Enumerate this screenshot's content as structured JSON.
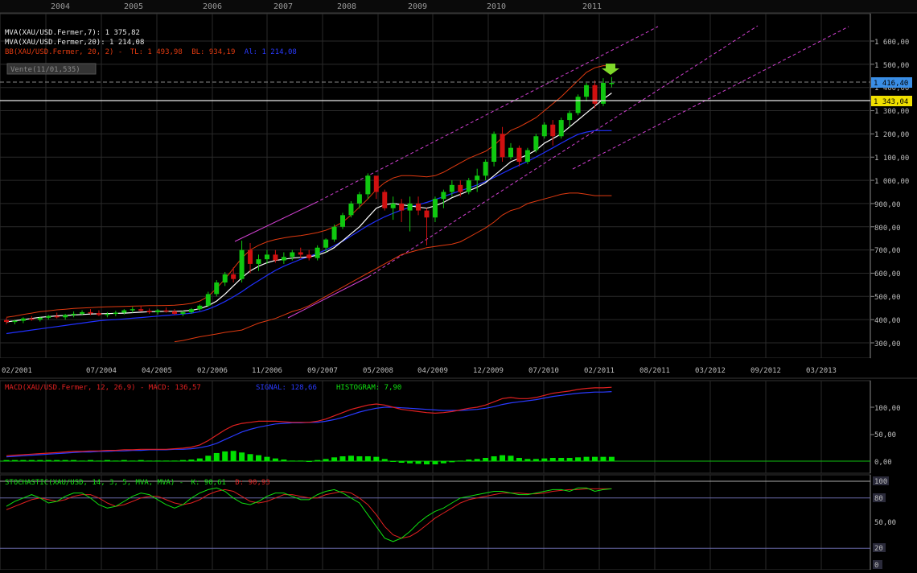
{
  "colors": {
    "background": "#000000",
    "grid": "#2a2a2a",
    "up_candle": "#10c810",
    "down_candle": "#d01010",
    "mva7": "#ffffff",
    "mva20": "#2030ff",
    "bb": "#e03a10",
    "trend": "#d040d0",
    "macd": "#e02020",
    "signal": "#2a3aff",
    "histogram": "#00e000",
    "stoch_k": "#10e010",
    "stoch_d": "#e02020",
    "price_badge": "#3a8ee6",
    "level_badge": "#f0e000"
  },
  "header": {
    "years": [
      "2004",
      "2005",
      "2006",
      "2007",
      "2008",
      "2009",
      "2010",
      "2011"
    ]
  },
  "price_panel": {
    "legend_mva7": "MVA(XAU/USD.Fermer,7): 1 375,82",
    "legend_mva20": "MVA(XAU/USD.Fermer,20): 1 214,08",
    "legend_bb_name": "BB(XAU/USD.Fermer, 20, 2) -",
    "legend_bb_tl": "TL: 1 493,98",
    "legend_bb_bl": "BL: 934,19",
    "legend_bb_al": "Al: 1 214,08",
    "order_label": "Vente(11/01,535)",
    "last_price": "1 416,40",
    "level_price": "1 343,04",
    "y_ticks": [
      "1 600,00",
      "1 500,00",
      "1 400,00",
      "1 300,00",
      "1 200,00",
      "1 100,00",
      "1 000,00",
      "900,00",
      "800,00",
      "700,00",
      "600,00",
      "500,00",
      "400,00",
      "300,00"
    ],
    "x_ticks": [
      "02/2001",
      "07/2004",
      "04/2005",
      "02/2006",
      "11/2006",
      "09/2007",
      "05/2008",
      "04/2009",
      "12/2009",
      "07/2010",
      "02/2011",
      "08/2011",
      "03/2012",
      "09/2012",
      "03/2013"
    ]
  },
  "macd_panel": {
    "legend_macd": "MACD(XAU/USD.Fermer, 12, 26,9) - MACD: 136,57",
    "legend_signal": "SIGNAL: 128,66",
    "legend_hist": "HISTOGRAM: 7,90",
    "y_ticks": [
      "100,00",
      "50,00",
      "0,00"
    ]
  },
  "stoch_panel": {
    "legend_name": "STOCHASTIC(XAU/USD, 14, 3, 5, MVA, MVA) -",
    "legend_k": "K: 90,61",
    "legend_d": "D: 90,93",
    "y_ticks": [
      "100",
      "80",
      "50,00",
      "20",
      "0"
    ]
  },
  "chart_data": {
    "type": "candlestick",
    "instrument": "XAU/USD",
    "ylim": [
      280,
      1660
    ],
    "candles": [
      [
        398,
        408,
        380,
        390
      ],
      [
        390,
        400,
        380,
        395
      ],
      [
        395,
        410,
        385,
        405
      ],
      [
        405,
        415,
        395,
        400
      ],
      [
        400,
        412,
        392,
        408
      ],
      [
        408,
        420,
        400,
        415
      ],
      [
        415,
        430,
        405,
        410
      ],
      [
        410,
        425,
        400,
        420
      ],
      [
        420,
        435,
        410,
        425
      ],
      [
        425,
        440,
        418,
        432
      ],
      [
        432,
        445,
        420,
        428
      ],
      [
        428,
        440,
        415,
        420
      ],
      [
        420,
        432,
        410,
        425
      ],
      [
        425,
        438,
        415,
        430
      ],
      [
        430,
        445,
        422,
        440
      ],
      [
        440,
        455,
        430,
        445
      ],
      [
        445,
        460,
        435,
        438
      ],
      [
        438,
        448,
        425,
        432
      ],
      [
        432,
        445,
        422,
        440
      ],
      [
        440,
        452,
        430,
        436
      ],
      [
        436,
        445,
        420,
        425
      ],
      [
        425,
        438,
        415,
        432
      ],
      [
        432,
        450,
        425,
        445
      ],
      [
        445,
        465,
        438,
        460
      ],
      [
        460,
        520,
        455,
        510
      ],
      [
        510,
        570,
        500,
        560
      ],
      [
        560,
        605,
        545,
        595
      ],
      [
        595,
        625,
        560,
        575
      ],
      [
        575,
        740,
        560,
        700
      ],
      [
        700,
        730,
        600,
        640
      ],
      [
        640,
        680,
        610,
        660
      ],
      [
        660,
        700,
        640,
        680
      ],
      [
        680,
        700,
        645,
        655
      ],
      [
        655,
        690,
        640,
        670
      ],
      [
        670,
        700,
        655,
        690
      ],
      [
        690,
        710,
        665,
        680
      ],
      [
        680,
        700,
        655,
        665
      ],
      [
        665,
        720,
        655,
        710
      ],
      [
        710,
        750,
        690,
        745
      ],
      [
        745,
        810,
        735,
        800
      ],
      [
        800,
        860,
        790,
        850
      ],
      [
        850,
        910,
        840,
        900
      ],
      [
        900,
        950,
        880,
        940
      ],
      [
        940,
        1030,
        920,
        1020
      ],
      [
        1020,
        1000,
        920,
        950
      ],
      [
        950,
        960,
        870,
        880
      ],
      [
        880,
        930,
        830,
        900
      ],
      [
        900,
        920,
        820,
        870
      ],
      [
        870,
        930,
        780,
        900
      ],
      [
        900,
        930,
        850,
        870
      ],
      [
        870,
        880,
        720,
        840
      ],
      [
        840,
        930,
        820,
        920
      ],
      [
        920,
        960,
        880,
        950
      ],
      [
        950,
        1000,
        930,
        980
      ],
      [
        980,
        1000,
        930,
        950
      ],
      [
        950,
        1010,
        940,
        1000
      ],
      [
        1000,
        1050,
        950,
        1020
      ],
      [
        1020,
        1090,
        1000,
        1080
      ],
      [
        1080,
        1210,
        1060,
        1200
      ],
      [
        1200,
        1230,
        1080,
        1100
      ],
      [
        1100,
        1160,
        1090,
        1140
      ],
      [
        1140,
        1150,
        1060,
        1080
      ],
      [
        1080,
        1140,
        1070,
        1130
      ],
      [
        1130,
        1200,
        1120,
        1190
      ],
      [
        1190,
        1250,
        1180,
        1240
      ],
      [
        1240,
        1260,
        1150,
        1190
      ],
      [
        1190,
        1270,
        1180,
        1260
      ],
      [
        1260,
        1300,
        1230,
        1290
      ],
      [
        1290,
        1370,
        1280,
        1360
      ],
      [
        1360,
        1420,
        1340,
        1410
      ],
      [
        1410,
        1430,
        1310,
        1330
      ],
      [
        1330,
        1440,
        1320,
        1420
      ],
      [
        1420,
        1445,
        1400,
        1420
      ]
    ],
    "mva7": [
      390,
      395,
      400,
      405,
      410,
      413,
      416,
      418,
      420,
      422,
      424,
      425,
      426,
      427,
      428,
      430,
      432,
      434,
      435,
      436,
      436,
      437,
      440,
      447,
      460,
      480,
      510,
      545,
      580,
      610,
      630,
      645,
      655,
      660,
      665,
      668,
      670,
      678,
      690,
      710,
      740,
      770,
      800,
      840,
      880,
      895,
      900,
      895,
      890,
      885,
      880,
      890,
      905,
      925,
      940,
      955,
      970,
      990,
      1020,
      1050,
      1080,
      1095,
      1110,
      1130,
      1160,
      1180,
      1200,
      1230,
      1260,
      1290,
      1320,
      1350,
      1376
    ],
    "mva20": [
      340,
      345,
      350,
      355,
      360,
      365,
      370,
      375,
      380,
      385,
      390,
      395,
      398,
      400,
      403,
      406,
      409,
      412,
      415,
      418,
      421,
      424,
      428,
      434,
      445,
      460,
      478,
      498,
      520,
      545,
      568,
      590,
      612,
      630,
      645,
      660,
      672,
      685,
      700,
      718,
      738,
      760,
      783,
      805,
      825,
      843,
      858,
      872,
      884,
      895,
      905,
      917,
      930,
      943,
      955,
      967,
      980,
      995,
      1012,
      1030,
      1048,
      1065,
      1082,
      1100,
      1120,
      1140,
      1160,
      1180,
      1198,
      1208,
      1214,
      1214,
      1214
    ],
    "bb_upper": [
      410,
      415,
      422,
      428,
      434,
      438,
      442,
      445,
      448,
      450,
      452,
      454,
      455,
      456,
      457,
      458,
      459,
      460,
      460,
      461,
      462,
      465,
      470,
      480,
      500,
      535,
      575,
      620,
      665,
      700,
      720,
      735,
      745,
      752,
      758,
      762,
      768,
      775,
      785,
      800,
      820,
      850,
      885,
      920,
      960,
      990,
      1010,
      1020,
      1020,
      1018,
      1015,
      1020,
      1035,
      1055,
      1075,
      1095,
      1110,
      1125,
      1150,
      1185,
      1215,
      1230,
      1250,
      1270,
      1300,
      1330,
      1360,
      1395,
      1430,
      1465,
      1485,
      1494,
      1494
    ],
    "bb_lower": [
      null,
      null,
      null,
      null,
      null,
      null,
      null,
      null,
      null,
      null,
      null,
      null,
      null,
      null,
      null,
      null,
      null,
      null,
      null,
      null,
      305,
      310,
      318,
      326,
      332,
      338,
      345,
      350,
      355,
      370,
      385,
      395,
      405,
      420,
      435,
      445,
      460,
      480,
      500,
      520,
      540,
      560,
      580,
      600,
      620,
      640,
      660,
      680,
      690,
      700,
      710,
      715,
      720,
      725,
      735,
      755,
      775,
      795,
      820,
      850,
      870,
      880,
      900,
      910,
      920,
      930,
      940,
      945,
      945,
      940,
      934,
      934,
      934
    ],
    "trend_lines": [
      {
        "from": [
          "05/2006",
          740
        ],
        "to": [
          "08/2007",
          900
        ]
      },
      {
        "from": [
          "08/2007",
          900
        ],
        "to": [
          "10/2011",
          1650
        ]
      },
      {
        "from": [
          "05/2007",
          400
        ],
        "to": [
          "09/2008",
          620
        ]
      },
      {
        "from": [
          "09/2008",
          620
        ],
        "to": [
          "12/2012",
          1650
        ]
      },
      {
        "from": [
          "10/2010",
          1150
        ],
        "to": [
          "05/2013",
          1660
        ]
      }
    ],
    "macd": {
      "macd": [
        10,
        11,
        12,
        13,
        14,
        15,
        16,
        17,
        18,
        18,
        19,
        19,
        20,
        20,
        21,
        21,
        22,
        22,
        22,
        22,
        23,
        24,
        26,
        30,
        38,
        48,
        58,
        66,
        70,
        72,
        74,
        74,
        74,
        73,
        72,
        72,
        72,
        74,
        78,
        84,
        90,
        96,
        100,
        104,
        106,
        104,
        100,
        96,
        94,
        92,
        90,
        89,
        90,
        92,
        95,
        98,
        100,
        104,
        110,
        116,
        118,
        116,
        116,
        118,
        122,
        126,
        128,
        130,
        133,
        135,
        136,
        136,
        137
      ],
      "signal": [
        8,
        9,
        10,
        11,
        12,
        13,
        14,
        15,
        16,
        17,
        17,
        18,
        18,
        19,
        19,
        20,
        20,
        21,
        21,
        21,
        22,
        22,
        23,
        25,
        28,
        33,
        40,
        47,
        54,
        59,
        63,
        66,
        69,
        70,
        71,
        71,
        72,
        72,
        74,
        77,
        81,
        86,
        91,
        95,
        98,
        100,
        100,
        99,
        98,
        97,
        96,
        95,
        94,
        94,
        94,
        95,
        96,
        98,
        101,
        105,
        108,
        110,
        112,
        114,
        117,
        120,
        122,
        124,
        126,
        127,
        128,
        128,
        129
      ],
      "histogram": [
        2,
        2,
        2,
        2,
        2,
        2,
        2,
        2,
        2,
        1,
        2,
        1,
        2,
        1,
        2,
        1,
        2,
        1,
        1,
        1,
        1,
        2,
        3,
        5,
        10,
        15,
        18,
        19,
        16,
        13,
        11,
        8,
        5,
        3,
        1,
        1,
        0,
        2,
        4,
        7,
        9,
        10,
        9,
        9,
        8,
        4,
        0,
        -3,
        -4,
        -5,
        -6,
        -6,
        -4,
        -2,
        1,
        3,
        4,
        6,
        9,
        11,
        10,
        6,
        4,
        4,
        5,
        6,
        6,
        6,
        7,
        8,
        8,
        8,
        8
      ],
      "ylim": [
        -20,
        150
      ]
    },
    "stochastic": {
      "k": [
        70,
        76,
        80,
        84,
        80,
        74,
        76,
        82,
        86,
        86,
        80,
        72,
        68,
        70,
        76,
        82,
        86,
        84,
        78,
        72,
        68,
        72,
        80,
        86,
        90,
        92,
        88,
        80,
        74,
        72,
        76,
        82,
        86,
        86,
        82,
        78,
        78,
        84,
        88,
        90,
        86,
        80,
        74,
        60,
        46,
        32,
        28,
        32,
        40,
        50,
        58,
        64,
        68,
        74,
        80,
        82,
        84,
        86,
        88,
        88,
        86,
        84,
        84,
        86,
        88,
        90,
        90,
        88,
        92,
        92,
        88,
        90,
        91
      ],
      "d": [
        66,
        70,
        74,
        78,
        80,
        78,
        76,
        78,
        82,
        84,
        84,
        80,
        74,
        70,
        72,
        76,
        80,
        82,
        82,
        78,
        74,
        72,
        74,
        78,
        84,
        88,
        90,
        88,
        82,
        76,
        74,
        76,
        80,
        84,
        84,
        82,
        80,
        80,
        84,
        86,
        88,
        86,
        80,
        72,
        60,
        46,
        36,
        32,
        34,
        40,
        48,
        56,
        62,
        68,
        74,
        78,
        80,
        82,
        84,
        86,
        86,
        86,
        85,
        85,
        86,
        88,
        89,
        90,
        90,
        91,
        91,
        91,
        91
      ],
      "levels": [
        100,
        80,
        20,
        0
      ]
    }
  }
}
